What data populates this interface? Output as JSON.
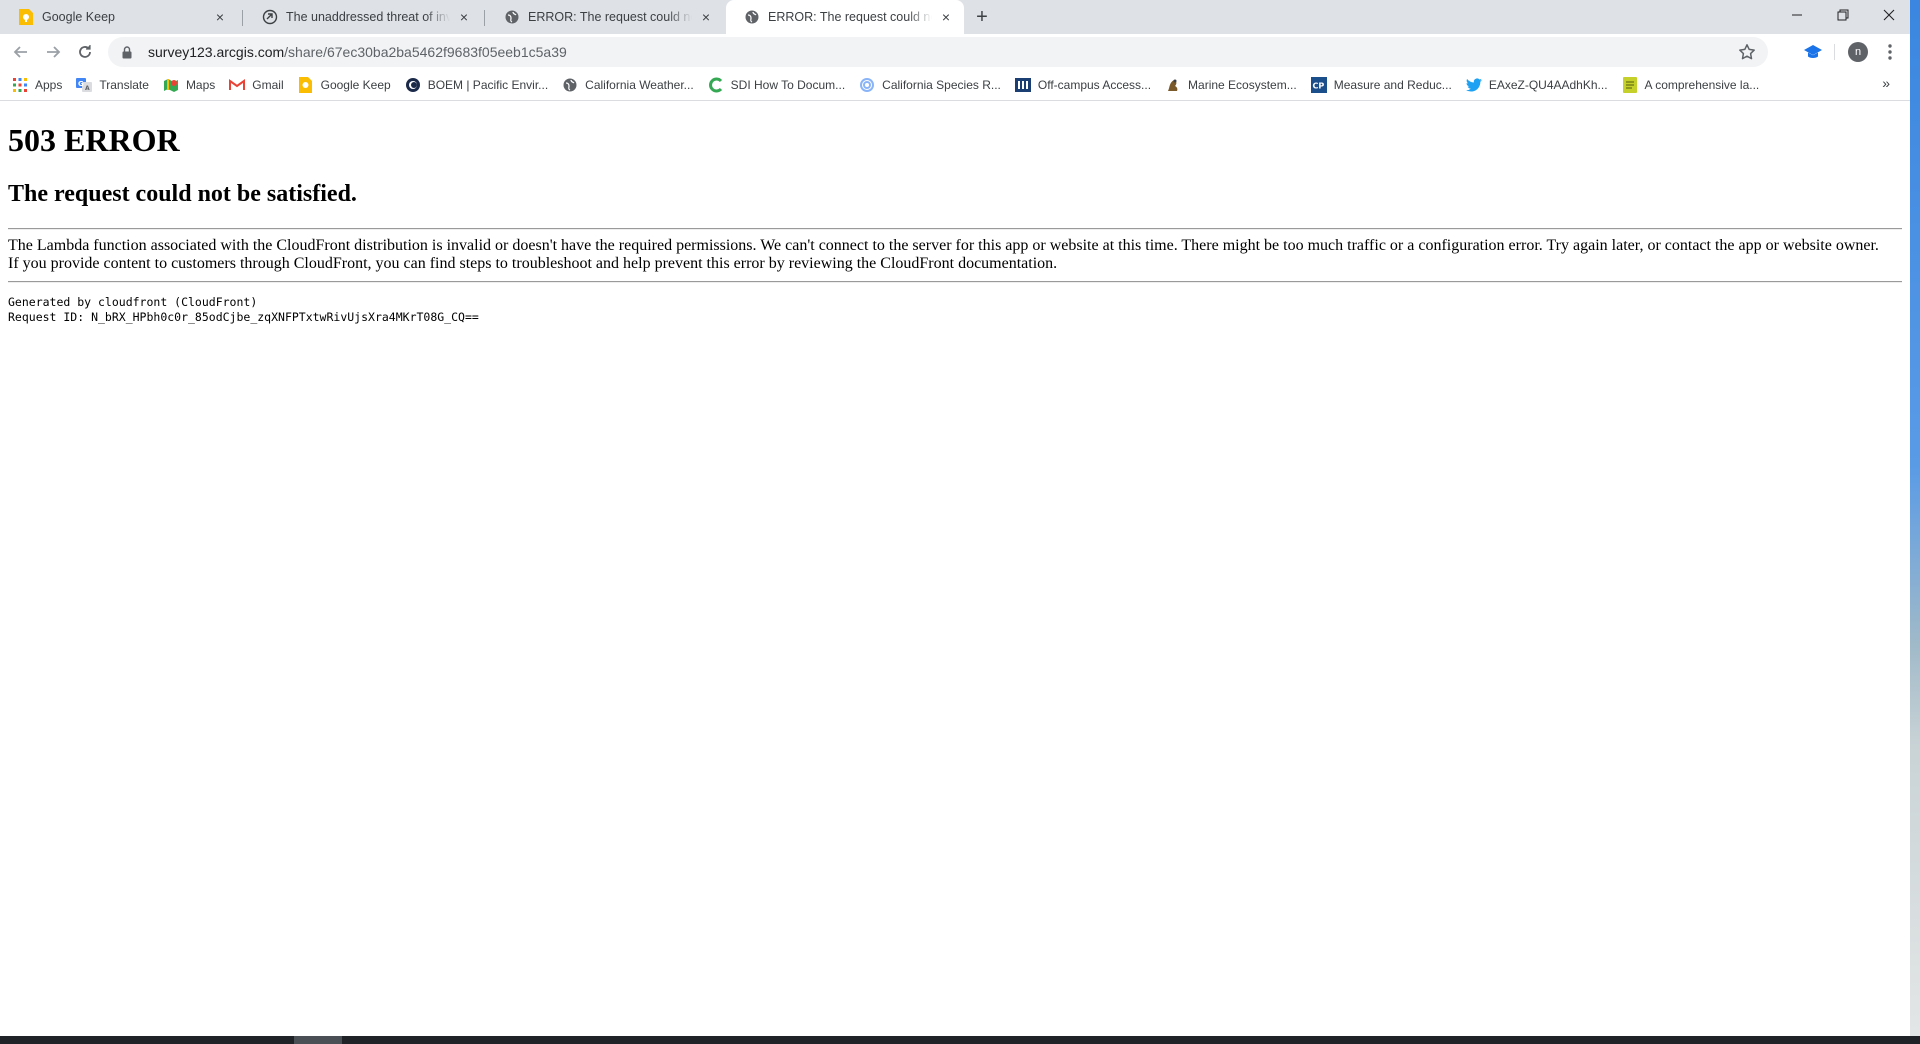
{
  "tabs": [
    {
      "title": "Google Keep",
      "icon": "google-keep-icon",
      "active": false
    },
    {
      "title": "The unaddressed threat of invasive",
      "icon": "article-icon",
      "active": false
    },
    {
      "title": "ERROR: The request could not be satisfied",
      "icon": "globe-icon",
      "active": false
    },
    {
      "title": "ERROR: The request could not be satisfied",
      "icon": "globe-icon",
      "active": true
    }
  ],
  "tab_close_glyph": "×",
  "new_tab_glyph": "+",
  "address_bar": {
    "host": "survey123.arcgis.com",
    "path": "/share/67ec30ba2ba5462f9683f05eeb1c5a39"
  },
  "profile": {
    "initial": "n"
  },
  "bookmarks": [
    {
      "label": "Apps",
      "icon": "apps-grid-icon"
    },
    {
      "label": "Translate",
      "icon": "translate-icon"
    },
    {
      "label": "Maps",
      "icon": "maps-icon"
    },
    {
      "label": "Gmail",
      "icon": "gmail-icon"
    },
    {
      "label": "Google Keep",
      "icon": "google-keep-icon"
    },
    {
      "label": "BOEM | Pacific Envir...",
      "icon": "boem-icon"
    },
    {
      "label": "California Weather...",
      "icon": "globe-icon"
    },
    {
      "label": "SDI How To Docum...",
      "icon": "sdi-icon"
    },
    {
      "label": "California Species R...",
      "icon": "species-icon"
    },
    {
      "label": "Off-campus Access...",
      "icon": "library-icon"
    },
    {
      "label": "Marine Ecosystem...",
      "icon": "marine-icon"
    },
    {
      "label": "Measure and Reduc...",
      "icon": "cp-icon"
    },
    {
      "label": "EAxeZ-QU4AAdhKh...",
      "icon": "twitter-icon"
    },
    {
      "label": "A comprehensive la...",
      "icon": "document-icon"
    }
  ],
  "bookmarks_overflow_glyph": "»",
  "page": {
    "heading": "503 ERROR",
    "subheading": "The request could not be satisfied.",
    "explanation_line1": "The Lambda function associated with the CloudFront distribution is invalid or doesn't have the required permissions. We can't connect to the server for this app or website at this time. There might be too much traffic or a configuration error. Try again later, or contact the app or website owner.",
    "explanation_line2": "If you provide content to customers through CloudFront, you can find steps to troubleshoot and help prevent this error by reviewing the CloudFront documentation.",
    "generated_by": "Generated by cloudfront (CloudFront)",
    "request_id": "Request ID: N_bRX_HPbh0c0r_85odCjbe_zqXNFPTxtwRivUjsXra4MKrT08G_CQ=="
  },
  "colors": {
    "tabstrip": "#dee1e6",
    "omnibox": "#f1f3f4",
    "accent_blue": "#1a73e8"
  }
}
